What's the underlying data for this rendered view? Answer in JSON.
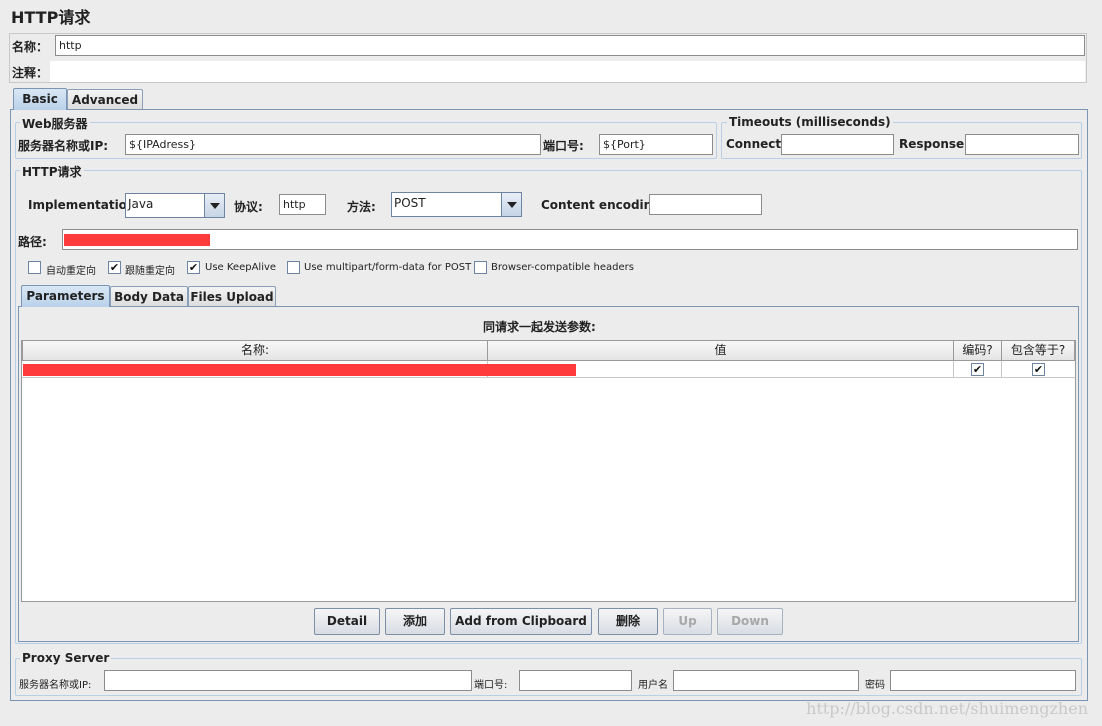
{
  "page_title": "HTTP请求",
  "name": {
    "label": "名称：",
    "value": "http"
  },
  "comment": {
    "label": "注释：",
    "value": ""
  },
  "tabs": {
    "basic": "Basic",
    "advanced": "Advanced"
  },
  "web_server": {
    "title": "Web服务器",
    "host_label": "服务器名称或IP:",
    "host_value": "${IPAdress}",
    "port_label": "端口号:",
    "port_value": "${Port}"
  },
  "timeouts": {
    "title": "Timeouts (milliseconds)",
    "connect_label": "Connect:",
    "connect_value": "",
    "response_label": "Response:",
    "response_value": ""
  },
  "http_request": {
    "title": "HTTP请求",
    "implementation_label": "Implementation:",
    "implementation_value": "Java",
    "protocol_label": "协议:",
    "protocol_value": "http",
    "method_label": "方法:",
    "method_value": "POST",
    "encoding_label": "Content encoding:",
    "encoding_value": "",
    "path_label": "路径:"
  },
  "options": [
    {
      "label": "自动重定向",
      "checked": false
    },
    {
      "label": "跟随重定向",
      "checked": true
    },
    {
      "label": "Use KeepAlive",
      "checked": true
    },
    {
      "label": "Use multipart/form-data for POST",
      "checked": false
    },
    {
      "label": "Browser-compatible headers",
      "checked": false
    }
  ],
  "check_glyph": "✔",
  "param_tabs": {
    "parameters": "Parameters",
    "body": "Body Data",
    "files": "Files Upload"
  },
  "params": {
    "caption": "同请求一起发送参数:",
    "columns": [
      "名称:",
      "值",
      "编码?",
      "包含等于?"
    ],
    "rows": [
      {
        "encode": true,
        "include_equals": true
      }
    ]
  },
  "buttons": {
    "detail": "Detail",
    "add": "添加",
    "clipboard": "Add from Clipboard",
    "delete": "删除",
    "up": "Up",
    "down": "Down"
  },
  "proxy": {
    "title": "Proxy Server",
    "host_label": "服务器名称或IP:",
    "port_label": "端口号:",
    "user_label": "用户名",
    "password_label": "密码"
  },
  "watermark": "http://blog.csdn.net/shuimengzhen",
  "colors": {
    "redaction": "#ff3b3b",
    "tab_active": "#b9d1ea",
    "border": "#7b95b5"
  }
}
